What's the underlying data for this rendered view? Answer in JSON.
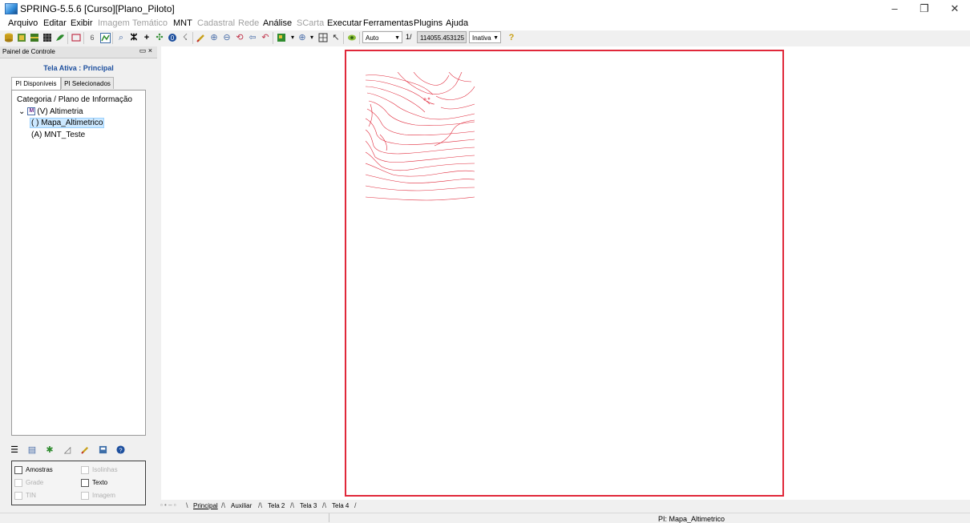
{
  "window": {
    "title": "SPRING-5.5.6 [Curso][Plano_Piloto]",
    "controls": {
      "minimize": "–",
      "maximize": "❐",
      "close": "✕"
    }
  },
  "menu": [
    {
      "label": "Arquivo",
      "enabled": true
    },
    {
      "label": "Editar",
      "enabled": true
    },
    {
      "label": "Exibir",
      "enabled": true
    },
    {
      "label": "Imagem",
      "enabled": false
    },
    {
      "label": "Temático",
      "enabled": false
    },
    {
      "label": "MNT",
      "enabled": true
    },
    {
      "label": "Cadastral",
      "enabled": false
    },
    {
      "label": "Rede",
      "enabled": false
    },
    {
      "label": "Análise",
      "enabled": true
    },
    {
      "label": "SCarta",
      "enabled": false
    },
    {
      "label": "Executar",
      "enabled": true
    },
    {
      "label": "Ferramentas",
      "enabled": true
    },
    {
      "label": "Plugins",
      "enabled": true
    },
    {
      "label": "Ajuda",
      "enabled": true
    }
  ],
  "toolbar": {
    "zoom_mode": "Auto",
    "scale_prefix": "1/",
    "scale_value": "114055.453125",
    "cursor_mode": "Inativa",
    "icon_names": [
      "database-icon",
      "project-icon",
      "category-icon",
      "grid-icon",
      "edit-icon",
      "window-icon",
      "number-icon",
      "model-icon",
      "zoom-area-icon",
      "zoom-fit-icon",
      "add-icon",
      "pan-icon",
      "info-icon",
      "pointer-icon",
      "pencil-icon",
      "zoom-in-icon",
      "zoom-out-icon",
      "zoom-previous-icon",
      "back-icon",
      "undo-icon",
      "draw-icon",
      "zoom-menu-icon",
      "screen-icon",
      "cursor-icon",
      "overlay-icon",
      "help-icon"
    ]
  },
  "panel": {
    "title": "Painel de Controle",
    "header_buttons": "▭ ×",
    "active_screen": "Tela Ativa : Principal",
    "tabs": [
      "PI Disponíveis",
      "PI Selecionados"
    ],
    "tree": {
      "header": "Categoria / Plano de Informação",
      "category": "(V) Altimetria",
      "category_badge": "M",
      "category_expander": "⌄",
      "items": [
        "( ) Mapa_Altimetrico",
        "(A) MNT_Teste"
      ],
      "selected_index": 0
    },
    "options": [
      {
        "label": "Amostras",
        "enabled": true
      },
      {
        "label": "Isolinhas",
        "enabled": false
      },
      {
        "label": "Grade",
        "enabled": false
      },
      {
        "label": "Texto",
        "enabled": true
      },
      {
        "label": "TIN",
        "enabled": false
      },
      {
        "label": "Imagem",
        "enabled": false
      }
    ]
  },
  "display_tabs": {
    "marks": "▫ • – ▫",
    "tabs": [
      "Principal",
      "Auxiliar",
      "Tela 2",
      "Tela 3",
      "Tela 4"
    ],
    "active": "Principal"
  },
  "status": {
    "pi_label": "PI: Mapa_Altimetrico"
  },
  "colors": {
    "map_frame": "#e0283a",
    "contour": "#e0283a",
    "accent": "#1d4f9e"
  }
}
